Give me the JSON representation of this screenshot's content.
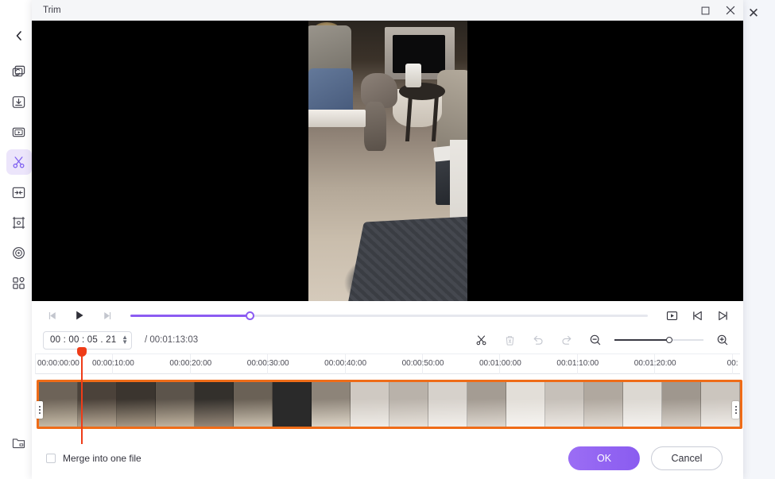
{
  "app": {
    "close_label": "✕",
    "collapse_icon": "chevron-left-icon",
    "sidebar": [
      {
        "name": "convert",
        "icon": "convert-video-icon"
      },
      {
        "name": "download",
        "icon": "download-icon"
      },
      {
        "name": "player",
        "icon": "video-player-icon"
      },
      {
        "name": "trim",
        "icon": "scissors-icon",
        "active": true
      },
      {
        "name": "merge",
        "icon": "merge-icon"
      },
      {
        "name": "crop",
        "icon": "crop-icon"
      },
      {
        "name": "record",
        "icon": "record-disc-icon"
      },
      {
        "name": "toolbox",
        "icon": "grid-apps-icon"
      }
    ],
    "sidebar_bottom": {
      "name": "open-folder",
      "icon": "folder-icon"
    }
  },
  "dialog": {
    "title": "Trim",
    "window_buttons": {
      "maximize": "□",
      "close": "✕"
    }
  },
  "preview": {
    "description": "vertical video of a dog walking in a living room near a fireplace"
  },
  "transport": {
    "prev_frame": "step-back-icon",
    "play": "play-icon",
    "next_frame": "step-forward-icon",
    "seek_percent": 23,
    "snapshot": "snapshot-icon",
    "jump_start": "jump-to-start-icon",
    "jump_end": "jump-to-end-icon"
  },
  "tools": {
    "timecode": "00 : 00 : 05 . 21",
    "duration": "/ 00:01:13:03",
    "cut": "scissors-icon",
    "delete": "delete-icon",
    "undo": "undo-icon",
    "redo": "redo-icon",
    "zoom_out": "zoom-out-icon",
    "zoom_in": "zoom-in-icon",
    "zoom_percent": 62
  },
  "ruler": {
    "labels": [
      "00:00:00:00",
      "00:00:10:00",
      "00:00:20:00",
      "00:00:30:00",
      "00:00:40:00",
      "00:00:50:00",
      "00:01:00:00",
      "00:01:10:00",
      "00:01:20:00",
      "00:"
    ]
  },
  "timeline": {
    "selection_color": "#ef6c18",
    "playhead_color": "#ef3c18",
    "thumbnails": [
      {
        "top": "#6d6358",
        "bottom": "#c8bda9"
      },
      {
        "top": "#4b423a",
        "bottom": "#b6a895"
      },
      {
        "top": "#3b352f",
        "bottom": "#a99b88"
      },
      {
        "top": "#5c544b",
        "bottom": "#c2b5a1"
      },
      {
        "top": "#33302c",
        "bottom": "#97897a"
      },
      {
        "top": "#6a6156",
        "bottom": "#cdc3b2"
      },
      {
        "top": "#514840",
        "bottom": "#b5a characteristics"
      },
      {
        "top": "#8d8479",
        "bottom": "#ded6c8"
      },
      {
        "top": "#cfc9c2",
        "bottom": "#efece7"
      },
      {
        "top": "#b9b2aa",
        "bottom": "#e6e1da"
      },
      {
        "top": "#d6d1cb",
        "bottom": "#f2efeb"
      },
      {
        "top": "#a49c93",
        "bottom": "#ddd7cf"
      },
      {
        "top": "#e2ded8",
        "bottom": "#f6f4f1"
      },
      {
        "top": "#c6c0b9",
        "bottom": "#ebe7e2"
      },
      {
        "top": "#b0a89f",
        "bottom": "#e0dbd4"
      },
      {
        "top": "#dcd8d2",
        "bottom": "#f4f2ef"
      },
      {
        "top": "#9f978e",
        "bottom": "#d8d2ca"
      },
      {
        "top": "#cbc5be",
        "bottom": "#efecE8"
      }
    ]
  },
  "footer": {
    "merge_label": "Merge into one file",
    "merge_checked": false,
    "ok_label": "OK",
    "cancel_label": "Cancel",
    "ok_color": "#8a5cf0"
  }
}
